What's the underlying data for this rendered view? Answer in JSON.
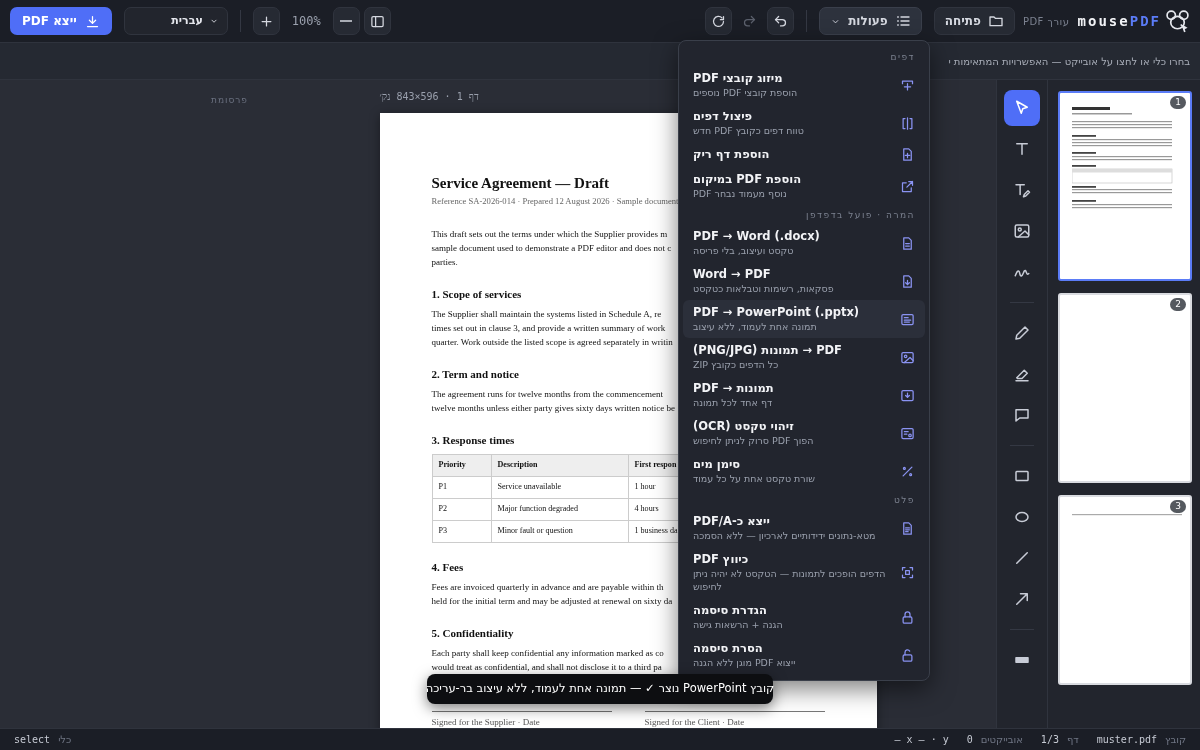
{
  "app": {
    "logo_text": "mouse",
    "logo_accent": "PDF",
    "subtitle": "עורך PDF"
  },
  "toolbar": {
    "open_button": "פתיחה",
    "actions_button": {
      "label": "פעולות",
      "expanded": true
    },
    "history": [
      {
        "kind": "undo",
        "disabled": false
      },
      {
        "kind": "redo",
        "disabled": true
      },
      {
        "kind": "refresh",
        "disabled": false
      }
    ],
    "zoom": "100%",
    "language": "עברית",
    "export_button": "ייצא PDF"
  },
  "hint": "בחרו כלי או לחצו על אובייקט — האפשרויות המתאימות י",
  "actions_menu": {
    "sections": [
      {
        "title": "דפים",
        "items": [
          {
            "kind": "merge",
            "title": "מיזוג קובצי PDF",
            "subtitle": "הוספת קובצי PDF נוספים",
            "highlighted": false
          },
          {
            "kind": "split",
            "title": "פיצול דפים",
            "subtitle": "טווח דפים כקובץ PDF חדש",
            "highlighted": false
          },
          {
            "kind": "blank",
            "title": "הוספת דף ריק",
            "highlighted": false
          },
          {
            "kind": "insert",
            "title": "הוספת PDF במיקום",
            "subtitle": "PDF נוסף מעמוד נבחר",
            "highlighted": false
          }
        ]
      },
      {
        "title": "המרה · פועל בדפדפן",
        "items": [
          {
            "kind": "doc",
            "title": "PDF → Word (.docx)",
            "subtitle": "טקסט ועיצוב, בלי פריסה",
            "highlighted": false
          },
          {
            "kind": "docdown",
            "title": "Word → PDF",
            "subtitle": "פסקאות, רשימות וטבלאות כטקסט",
            "highlighted": false
          },
          {
            "kind": "slides",
            "title": "PDF → PowerPoint (.pptx)",
            "subtitle": "תמונה אחת לעמוד, ללא עיצוב",
            "highlighted": true
          },
          {
            "kind": "image",
            "title": "(PNG/JPG) תמונות → PDF",
            "subtitle": "כל הדפים כקובץ ZIP",
            "highlighted": false
          },
          {
            "kind": "toimages",
            "title": "PDF → תמונות",
            "subtitle": "דף אחד לכל תמונה",
            "highlighted": false
          },
          {
            "kind": "ocr",
            "title": "זיהוי טקסט (OCR)",
            "subtitle": "הפוך PDF סרוק לניתן לחיפוש",
            "highlighted": false
          },
          {
            "kind": "watermark",
            "title": "סימן מים",
            "subtitle": "שורת טקסט אחת על כל עמוד",
            "highlighted": false
          }
        ]
      },
      {
        "title": "פלט",
        "items": [
          {
            "kind": "pdfa",
            "title": "ייצא כ-PDF/A",
            "subtitle": "מטא-נתונים ידידותיים לארכיון — ללא הסמכה",
            "highlighted": false
          },
          {
            "kind": "compress",
            "title": "כיווץ PDF",
            "subtitle": "הדפים הופכים לתמונות — הטקסט לא יהיה ניתן לחיפוש",
            "highlighted": false
          },
          {
            "kind": "lock",
            "title": "הגדרת סיסמה",
            "subtitle": "הגנה + הרשאות גישה",
            "highlighted": false
          },
          {
            "kind": "unlock",
            "title": "הסרת סיסמה",
            "subtitle": "ייצוא PDF מוגן ללא הגנה",
            "highlighted": false
          }
        ]
      }
    ]
  },
  "page_label": "דף 1 · 596×843 נק׳",
  "ad_label": "פרסומת",
  "document": {
    "title": "Service Agreement — Draft",
    "meta": "Reference SA-2026-014 · Prepared 12 August 2026 · Sample document",
    "blocks": [
      {
        "kind": "paragraph",
        "lines": [
          "This draft sets out the terms under which the Supplier provides m",
          "sample document used to demonstrate a PDF editor and does not c",
          "parties."
        ]
      },
      {
        "kind": "heading",
        "text": "1. Scope of services"
      },
      {
        "kind": "paragraph",
        "lines": [
          "The Supplier shall maintain the systems listed in Schedule A, re",
          "times set out in clause 3, and provide a written summary of work",
          "quarter. Work outside the listed scope is agreed separately in writin"
        ]
      },
      {
        "kind": "heading",
        "text": "2. Term and notice"
      },
      {
        "kind": "paragraph",
        "lines": [
          "The agreement runs for twelve months from the commencement",
          "twelve months unless either party gives sixty days written notice be"
        ]
      },
      {
        "kind": "heading",
        "text": "3. Response times"
      },
      {
        "kind": "table",
        "header": {
          "column_1": "Priority",
          "column_2": "Description",
          "column_3": "First respon"
        },
        "rows": [
          {
            "column_1": "P1",
            "column_2": "Service unavailable",
            "column_3": "1 hour"
          },
          {
            "column_1": "P2",
            "column_2": "Major function degraded",
            "column_3": "4 hours"
          },
          {
            "column_1": "P3",
            "column_2": "Minor fault or question",
            "column_3": "1 business da"
          }
        ]
      },
      {
        "kind": "heading",
        "text": "4. Fees"
      },
      {
        "kind": "paragraph",
        "lines": [
          "Fees are invoiced quarterly in advance and are payable within th",
          "held for the initial term and may be adjusted at renewal on sixty da"
        ]
      },
      {
        "kind": "heading",
        "text": "5. Confidentiality"
      },
      {
        "kind": "paragraph",
        "lines": [
          "Each party shall keep confidential any information marked as co",
          "would treat as confidential, and shall not disclose it to a third pa"
        ]
      }
    ],
    "signatures": {
      "left": "Signed for the Supplier · Date",
      "right": "Signed for the Client · Date"
    }
  },
  "tool_groups": [
    {
      "tools": [
        {
          "kind": "select",
          "selected": true
        },
        {
          "kind": "text",
          "selected": false
        },
        {
          "kind": "textedit",
          "selected": false
        },
        {
          "kind": "image",
          "selected": false
        },
        {
          "kind": "signature",
          "selected": false
        }
      ]
    },
    {
      "tools": [
        {
          "kind": "pencil",
          "selected": false
        },
        {
          "kind": "highlighter",
          "selected": false
        },
        {
          "kind": "comment",
          "selected": false
        }
      ]
    },
    {
      "tools": [
        {
          "kind": "rectangle",
          "selected": false
        },
        {
          "kind": "ellipse",
          "selected": false
        },
        {
          "kind": "line",
          "selected": false
        },
        {
          "kind": "arrow",
          "selected": false
        }
      ]
    },
    {
      "tools": [
        {
          "kind": "redact",
          "selected": false
        }
      ]
    }
  ],
  "thumbnails": [
    {
      "number": "1",
      "kind": "content",
      "selected": true
    },
    {
      "number": "2",
      "kind": "blank",
      "selected": false
    },
    {
      "number": "3",
      "kind": "signature",
      "selected": false
    }
  ],
  "toast": "קובץ PowerPoint נוצר ✓ — תמונה אחת לעמוד, ללא עיצוב בר-עריכה",
  "status_bar": {
    "file_label": "קובץ",
    "file": "muster.pdf",
    "page_label": "דף",
    "page": "1/3",
    "objects_label": "אובייקטים",
    "objects": "0",
    "coords": "– x – · y",
    "tool_label": "כלי",
    "tool": "select"
  }
}
